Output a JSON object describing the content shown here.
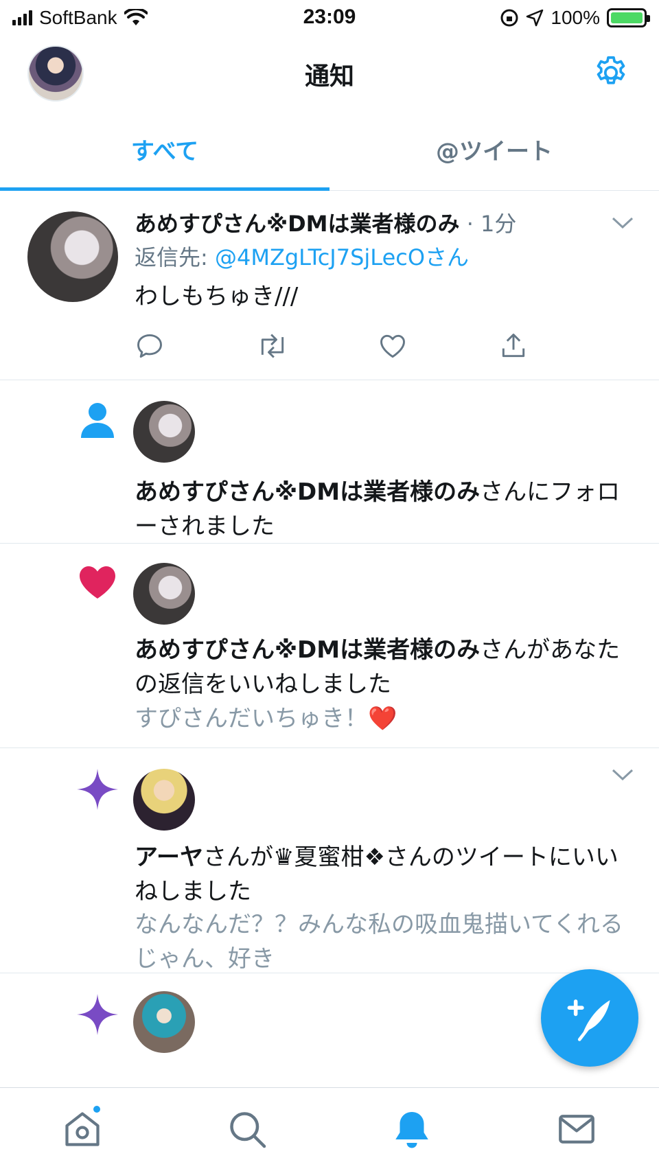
{
  "status_bar": {
    "carrier": "SoftBank",
    "time": "23:09",
    "battery": "100%"
  },
  "header": {
    "title": "通知"
  },
  "tabs": [
    {
      "label": "すべて",
      "active": true
    },
    {
      "label": "@ツイート",
      "active": false
    }
  ],
  "tweet": {
    "name": "あめすぴさん※DMは業者様のみ",
    "time": "· 1分",
    "reply_prefix": "返信先: ",
    "reply_handle": "@4MZgLTcJ7SjLecOさん",
    "text": "わしもちゅき///"
  },
  "notifications": [
    {
      "type": "follow",
      "name": "あめすぴさん※DMは業者様のみ",
      "rest": "さんにフォローされました"
    },
    {
      "type": "like",
      "name": "あめすぴさん※DMは業者様のみ",
      "rest": "さんがあなたの返信をいいねしました",
      "quote": "すぴさんだいちゅき！❤️"
    },
    {
      "type": "activity",
      "name": "アーヤ",
      "rest": "さんが♛夏蜜柑❖さんのツイートにいいねしました",
      "quote": "なんなんだ？？みんな私の吸血鬼描いてくれるじゃん、好き"
    }
  ],
  "colors": {
    "accent": "#1da1f2",
    "like": "#e0245e",
    "sparkle": "#794bc4",
    "muted": "#657786"
  },
  "icons": {
    "tweet_actions": [
      "reply-icon",
      "retweet-icon",
      "like-icon",
      "share-icon"
    ],
    "bottom_nav": [
      "home-icon",
      "search-icon",
      "notifications-icon",
      "messages-icon"
    ]
  }
}
